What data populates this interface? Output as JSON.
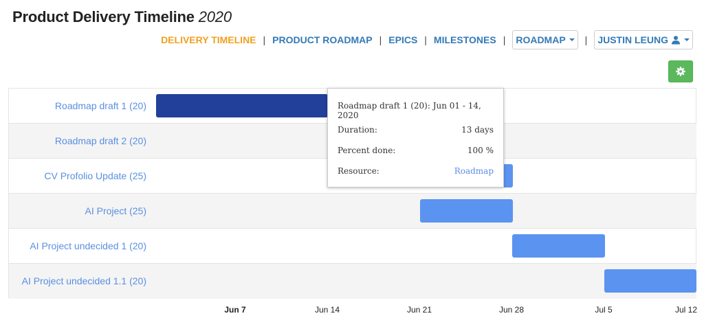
{
  "header": {
    "title": "Product Delivery Timeline",
    "year": "2020"
  },
  "nav": {
    "delivery_timeline": "DELIVERY TIMELINE",
    "product_roadmap": "PRODUCT ROADMAP",
    "epics": "EPICS",
    "milestones": "MILESTONES",
    "separator": "|",
    "roadmap_dropdown": "ROADMAP",
    "user_dropdown": "JUSTIN LEUNG"
  },
  "colors": {
    "active_nav": "#f0a020",
    "nav_link": "#337ab7",
    "bar": "#5b93f0",
    "bar_selected": "#22409a",
    "settings_button": "#5cb85c"
  },
  "timeline": {
    "rows": [
      {
        "label": "Roadmap draft 1 (20)",
        "start": "2020-06-01",
        "end": "2020-06-14",
        "selected": true
      },
      {
        "label": "Roadmap draft 2 (20)"
      },
      {
        "label": "CV Profolio Update (25)",
        "end": "2020-06-28"
      },
      {
        "label": "AI Project (25)",
        "start": "2020-06-21",
        "end": "2020-06-28"
      },
      {
        "label": "AI Project undecided 1 (20)",
        "start": "2020-06-28",
        "end": "2020-07-05"
      },
      {
        "label": "AI Project undecided 1.1 (20)",
        "start": "2020-07-05",
        "end": "2020-07-12"
      }
    ],
    "axis_ticks": [
      "Jun 7",
      "Jun 14",
      "Jun 21",
      "Jun 28",
      "Jul 5",
      "Jul 12"
    ]
  },
  "tooltip": {
    "title": "Roadmap draft 1 (20): Jun 01 - 14, 2020",
    "duration_label": "Duration:",
    "duration_value": "13 days",
    "percent_label": "Percent done:",
    "percent_value": "100 %",
    "resource_label": "Resource:",
    "resource_value": "Roadmap"
  }
}
